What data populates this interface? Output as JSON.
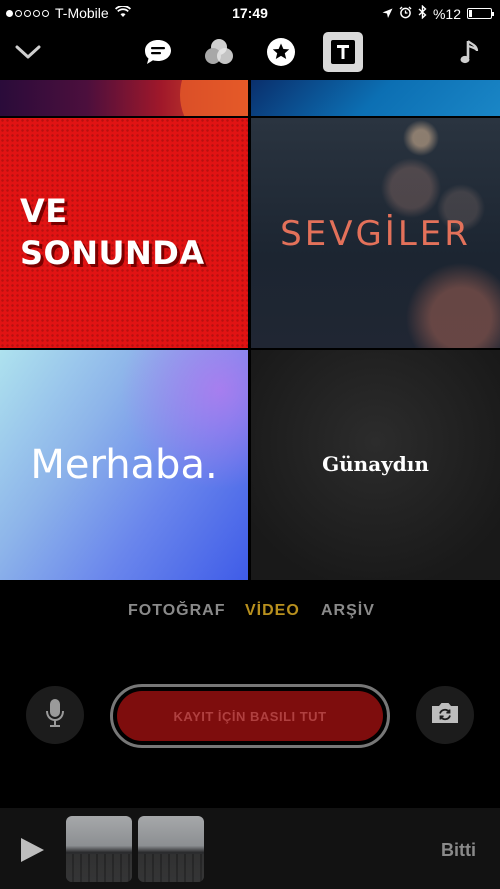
{
  "status_bar": {
    "carrier": "T-Mobile",
    "time": "17:49",
    "battery": "%12",
    "icons": [
      "signal-dots",
      "wifi-icon",
      "location-icon",
      "alarm-icon",
      "bluetooth-icon",
      "battery-icon"
    ]
  },
  "toolbar": {
    "items": [
      "chevron-down-icon",
      "speech-bubble-icon",
      "filters-icon",
      "star-icon",
      "title-posters-icon",
      "music-note-icon"
    ],
    "selected": "title-posters-icon"
  },
  "posters": {
    "red_line1": "VE",
    "red_line2": "SONUNDA",
    "bokeh_text": "SEVGİLER",
    "blue_text": "Merhaba.",
    "dark_text": "Günaydın"
  },
  "modes": {
    "photo": "FOTOĞRAF",
    "video": "VİDEO",
    "archive": "ARŞİV",
    "active": "video",
    "active_color": "#b8901e",
    "inactive_color": "#8a8a8a"
  },
  "controls": {
    "record_label": "KAYIT İÇİN BASILI TUT",
    "mic_icon": "microphone-icon",
    "flip_icon": "camera-flip-icon"
  },
  "bottom": {
    "done_label": "Bitti",
    "play_icon": "play-icon"
  }
}
